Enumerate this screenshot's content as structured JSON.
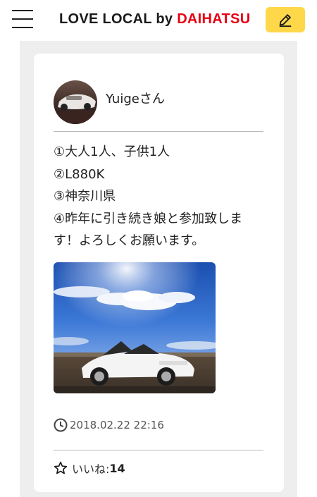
{
  "header": {
    "logo_part1": "LOVE LOCAL",
    "logo_part2": " by ",
    "logo_part3": "DAIHATSU",
    "menu_icon": "hamburger-menu-icon",
    "edit_icon": "pencil-icon",
    "edit_button_color": "#ffd84a"
  },
  "post": {
    "username": "Yuigeさん",
    "lines": [
      "①大人1人、子供1人",
      "②L880K",
      "③神奈川県",
      "④昨年に引き続き娘と参加致しま",
      "す！よろしくお願います。"
    ],
    "timestamp": "2018.02.22 22:16",
    "clock_icon": "clock-icon",
    "likes_label": "いいね:",
    "likes_count": "14",
    "star_icon": "star-outline-icon"
  },
  "colors": {
    "brand_red": "#e60012",
    "background_gray": "#eeeeee"
  }
}
